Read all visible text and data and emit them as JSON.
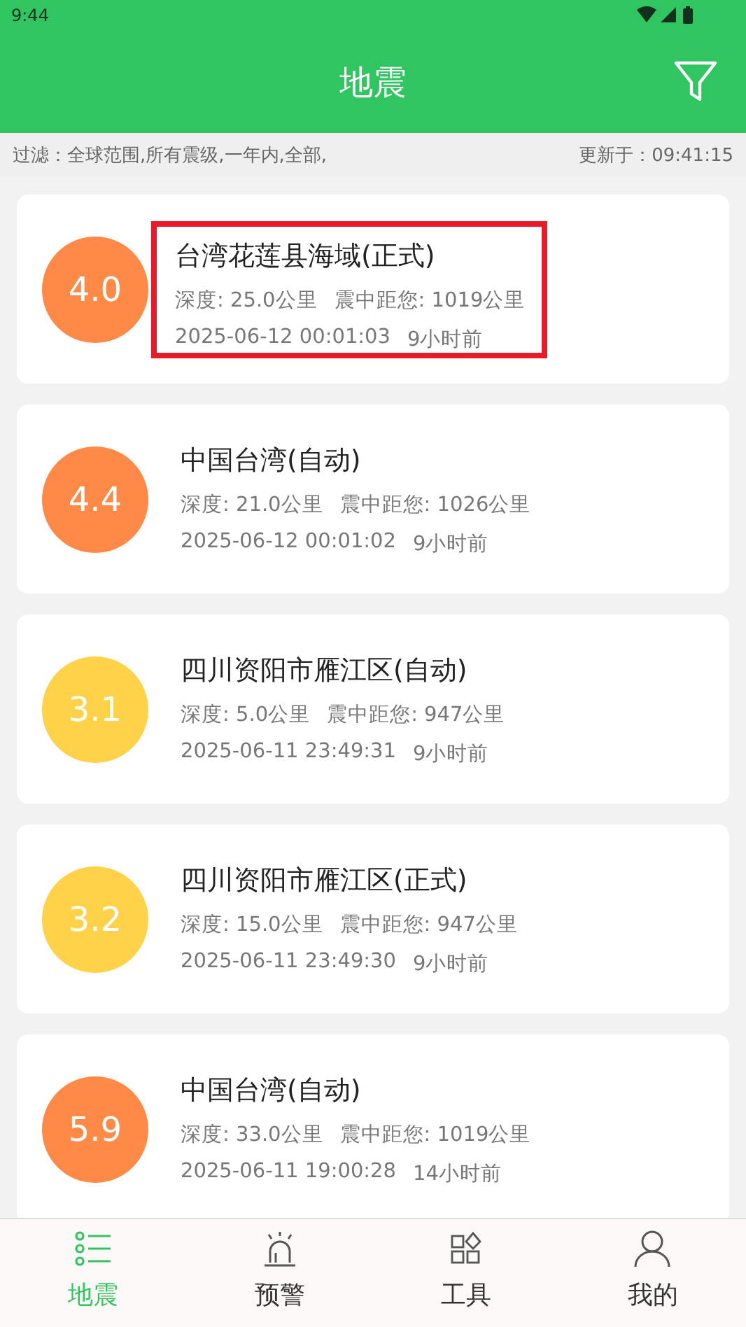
{
  "status_bar": {
    "time": "9:44"
  },
  "header": {
    "title": "地震"
  },
  "filter_bar": {
    "filter": "过滤：全球范围,所有震级,一年内,全部,",
    "updated": "更新于：09:41:15"
  },
  "quakes": [
    {
      "magnitude": "4.0",
      "color": "#ff8a48",
      "place": "台湾花莲县海域(正式)",
      "depth": "深度: 25.0公里",
      "distance": "震中距您: 1019公里",
      "datetime": "2025-06-12 00:01:03",
      "ago": "9小时前",
      "highlighted": true
    },
    {
      "magnitude": "4.4",
      "color": "#ff8a48",
      "place": "中国台湾(自动)",
      "depth": "深度: 21.0公里",
      "distance": "震中距您: 1026公里",
      "datetime": "2025-06-12 00:01:02",
      "ago": "9小时前",
      "highlighted": false
    },
    {
      "magnitude": "3.1",
      "color": "#ffd24a",
      "place": "四川资阳市雁江区(自动)",
      "depth": "深度: 5.0公里",
      "distance": "震中距您: 947公里",
      "datetime": "2025-06-11 23:49:31",
      "ago": "9小时前",
      "highlighted": false
    },
    {
      "magnitude": "3.2",
      "color": "#ffd24a",
      "place": "四川资阳市雁江区(正式)",
      "depth": "深度: 15.0公里",
      "distance": "震中距您: 947公里",
      "datetime": "2025-06-11 23:49:30",
      "ago": "9小时前",
      "highlighted": false
    },
    {
      "magnitude": "5.9",
      "color": "#ff8a48",
      "place": "中国台湾(自动)",
      "depth": "深度: 33.0公里",
      "distance": "震中距您: 1019公里",
      "datetime": "2025-06-11 19:00:28",
      "ago": "14小时前",
      "highlighted": false
    }
  ],
  "nav": [
    {
      "kind": "list",
      "label": "地震",
      "selected": true
    },
    {
      "kind": "alarm",
      "label": "预警",
      "selected": false
    },
    {
      "kind": "tools",
      "label": "工具",
      "selected": false
    },
    {
      "kind": "user",
      "label": "我的",
      "selected": false
    }
  ]
}
